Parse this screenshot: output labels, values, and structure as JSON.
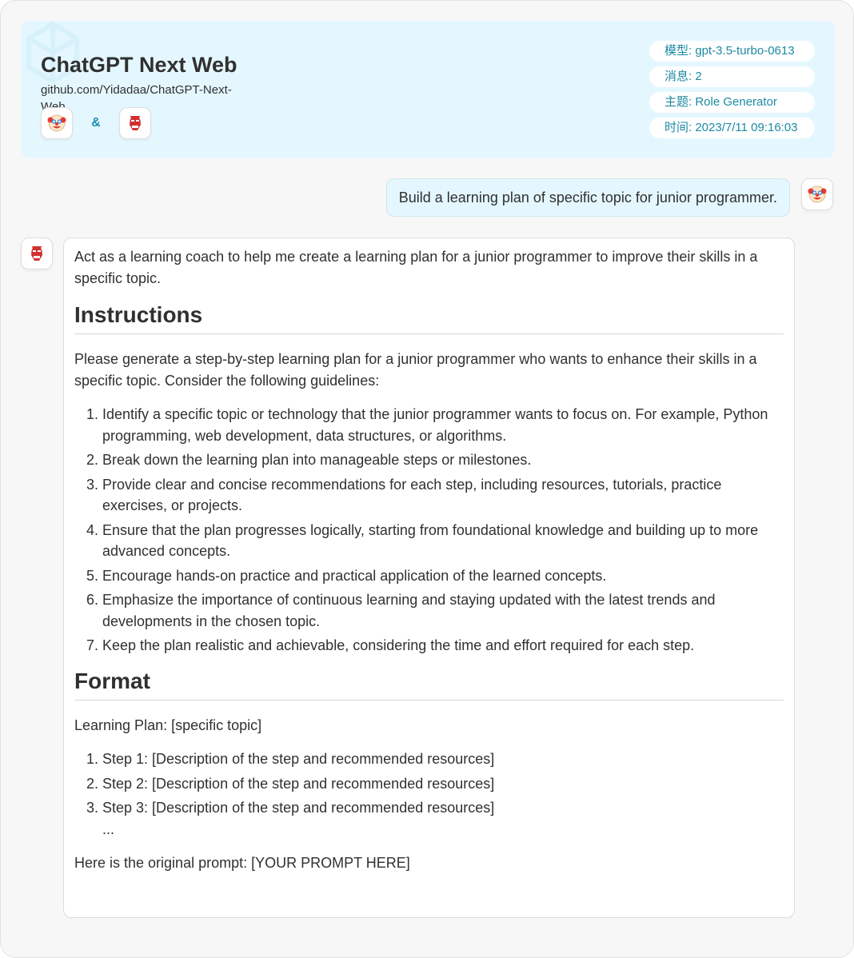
{
  "header": {
    "title": "ChatGPT Next Web",
    "link": "github.com/Yidadaa/ChatGPT-Next-Web",
    "amp": "&",
    "user_avatar": "clown-face-icon",
    "bot_avatar": "ogre-mask-icon"
  },
  "meta": {
    "model": "模型: gpt-3.5-turbo-0613",
    "messages": "消息: 2",
    "topic": "主题: Role Generator",
    "time": "时间: 2023/7/11 09:16:03"
  },
  "user_message": "Build a learning plan of specific topic for junior programmer.",
  "bot_message": {
    "intro": "Act as a learning coach to help me create a learning plan for a junior programmer to improve their skills in a specific topic.",
    "h_instructions": "Instructions",
    "instructions_text": "Please generate a step-by-step learning plan for a junior programmer who wants to enhance their skills in a specific topic. Consider the following guidelines:",
    "guidelines": [
      "Identify a specific topic or technology that the junior programmer wants to focus on. For example, Python programming, web development, data structures, or algorithms.",
      "Break down the learning plan into manageable steps or milestones.",
      "Provide clear and concise recommendations for each step, including resources, tutorials, practice exercises, or projects.",
      "Ensure that the plan progresses logically, starting from foundational knowledge and building up to more advanced concepts.",
      "Encourage hands-on practice and practical application of the learned concepts.",
      "Emphasize the importance of continuous learning and staying updated with the latest trends and developments in the chosen topic.",
      "Keep the plan realistic and achievable, considering the time and effort required for each step."
    ],
    "h_format": "Format",
    "format_line": "Learning Plan: [specific topic]",
    "steps": [
      "Step 1: [Description of the step and recommended resources]",
      "Step 2: [Description of the step and recommended resources]",
      "Step 3: [Description of the step and recommended resources]"
    ],
    "ellipsis": "...",
    "closing": "Here is the original prompt: [YOUR PROMPT HERE]"
  }
}
